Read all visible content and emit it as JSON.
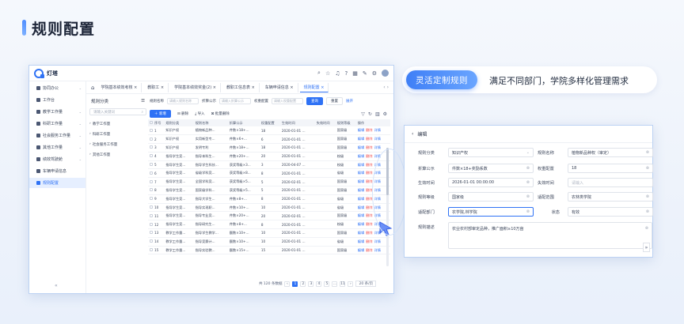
{
  "page_title": "规则配置",
  "app": {
    "logo_text": "灯塔",
    "topbar_icons": [
      "search-icon",
      "star-icon",
      "bell-icon",
      "help-icon",
      "grid-icon",
      "tool-icon",
      "settings-icon",
      "avatar"
    ],
    "sidebar": [
      {
        "label": "协同办公",
        "icon": "users-icon",
        "caret": true
      },
      {
        "label": "工作台",
        "icon": "dashboard-icon",
        "caret": false
      },
      {
        "label": "教学工作量",
        "icon": "book-icon",
        "caret": true
      },
      {
        "label": "科研工作量",
        "icon": "flask-icon",
        "caret": true
      },
      {
        "label": "社会服务工作量",
        "icon": "service-icon",
        "caret": true
      },
      {
        "label": "其他工作量",
        "icon": "folder-icon",
        "caret": true
      },
      {
        "label": "绩效驾驶舱",
        "icon": "chart-icon",
        "caret": true
      },
      {
        "label": "车辆申请信息",
        "icon": "car-icon",
        "caret": false
      },
      {
        "label": "规则配置",
        "icon": "rule-icon",
        "caret": false,
        "active": true
      }
    ],
    "tabs": [
      {
        "label": "学院基本绩效考核",
        "active": false
      },
      {
        "label": "教职工",
        "active": false
      },
      {
        "label": "学院基本绩效奖金(2)",
        "active": false
      },
      {
        "label": "教职工信息表",
        "active": false
      },
      {
        "label": "车辆申请信息",
        "active": false
      },
      {
        "label": "规则配置",
        "active": true
      }
    ],
    "tree": {
      "title": "规则分类",
      "search_placeholder": "请输入关键词",
      "nodes": [
        "教学工作量",
        "科研工作量",
        "社会服务工作量",
        "其他工作量"
      ]
    },
    "filters": {
      "name_label": "规则名称",
      "name_placeholder": "请输入规则名称",
      "formula_label": "折算公示",
      "formula_placeholder": "请输入折算公示",
      "weight_label": "权重配置",
      "weight_placeholder": "请输入权重配置",
      "query": "查询",
      "reset": "重置",
      "expand": "展开"
    },
    "actions": {
      "add": "新增",
      "delete": "删除",
      "import": "导入",
      "export": "批量删除"
    },
    "table": {
      "columns": [
        "序号",
        "规则分类",
        "规则名称",
        "折算公示",
        "权重配置",
        "生效时间",
        "失效时间",
        "规则等级",
        "操作"
      ],
      "rows": [
        [
          "1",
          "知识产权",
          "植物新品种...",
          "件数×18+...",
          "18",
          "2020-01-01 ...",
          "",
          "国家级"
        ],
        [
          "2",
          "知识产权",
          "实用新型专...",
          "件数×6+...",
          "6",
          "2020-01-01 ...",
          "",
          "国家级"
        ],
        [
          "3",
          "知识产权",
          "发明专利",
          "件数×18+...",
          "18",
          "2020-01-01 ...",
          "",
          "国家级"
        ],
        [
          "4",
          "指导学生竞...",
          "指导本科生...",
          "件数×20+...",
          "20",
          "2020-01-01 ...",
          "",
          "校级"
        ],
        [
          "5",
          "指导学生竞...",
          "指导学生科技...",
          "获奖等级×3...",
          "3",
          "2020-04-07 ...",
          "",
          "校级"
        ],
        [
          "6",
          "指导学生竞...",
          "省级学科竞...",
          "获奖等级×8...",
          "8",
          "2020-01-01 ...",
          "",
          "省级"
        ],
        [
          "7",
          "指导学生竞...",
          "全国学科竞...",
          "获奖等级×5...",
          "5",
          "2020-02-01 ...",
          "",
          "国家级"
        ],
        [
          "8",
          "指导学生竞...",
          "国家级学科...",
          "获奖等级×5...",
          "5",
          "2020-01-01 ...",
          "",
          "国家级"
        ],
        [
          "9",
          "指导学生竞...",
          "指导大学生...",
          "件数×8+...",
          "8",
          "2020-01-01 ...",
          "",
          "省级"
        ],
        [
          "10",
          "指导学生竞...",
          "指导实现职...",
          "件数×10+...",
          "10",
          "2020-01-01 ...",
          "",
          "省级"
        ],
        [
          "11",
          "指导学生竞...",
          "指导专业竞...",
          "件数×20+...",
          "20",
          "2020-02-01 ...",
          "",
          "国家级"
        ],
        [
          "12",
          "指导学生竞...",
          "指导研究生...",
          "件数×8+...",
          "8",
          "2020-01-01 ...",
          "",
          "校级"
        ],
        [
          "13",
          "教学工作量...",
          "指导学生教学...",
          "额数×10+...",
          "10",
          "2020-01-01 ...",
          "",
          "国家级"
        ],
        [
          "14",
          "教学工作量...",
          "指导竞赛计...",
          "额数×10+...",
          "10",
          "2020-01-01 ...",
          "",
          "省级"
        ],
        [
          "15",
          "教学工作量...",
          "指导实验教...",
          "额数×15+...",
          "15",
          "2020-01-01 ...",
          "",
          "国家级"
        ]
      ],
      "op_edit": "编辑",
      "op_delete": "删除",
      "op_detail": "详情"
    },
    "pager": {
      "total": "共 120 条数据",
      "pages": [
        "1",
        "2",
        "3",
        "4",
        "5",
        "...",
        "11"
      ],
      "current": "1",
      "size": "20 条/页"
    }
  },
  "feature": {
    "pill": "灵活定制规则",
    "desc": "满足不同部门，学院多样化管理需求"
  },
  "form": {
    "title": "编辑",
    "fields": {
      "category": {
        "label": "规则分类",
        "value": "知识产权"
      },
      "name": {
        "label": "规则名称",
        "value": "植物新品种权（审定）"
      },
      "formula": {
        "label": "折算公示",
        "value": "件数×18+奖励系数"
      },
      "weight": {
        "label": "权重配置",
        "value": "18"
      },
      "start": {
        "label": "生效时间",
        "value": "2026-01-01 00:00:00"
      },
      "end": {
        "label": "失效时间",
        "placeholder": "请输入"
      },
      "level": {
        "label": "规则等级",
        "value": "国家级"
      },
      "scope": {
        "label": "适配范围",
        "value": "农林类学院"
      },
      "dept": {
        "label": "适配部门",
        "value": "农学院,林学院"
      },
      "status": {
        "label": "状态",
        "value": "有效"
      },
      "desc": {
        "label": "规则描述",
        "value": "农业农村部审定品种，推广面积≥10万亩"
      }
    }
  },
  "colors": {
    "accent": "#2f72f5",
    "danger": "#f04a4a"
  }
}
